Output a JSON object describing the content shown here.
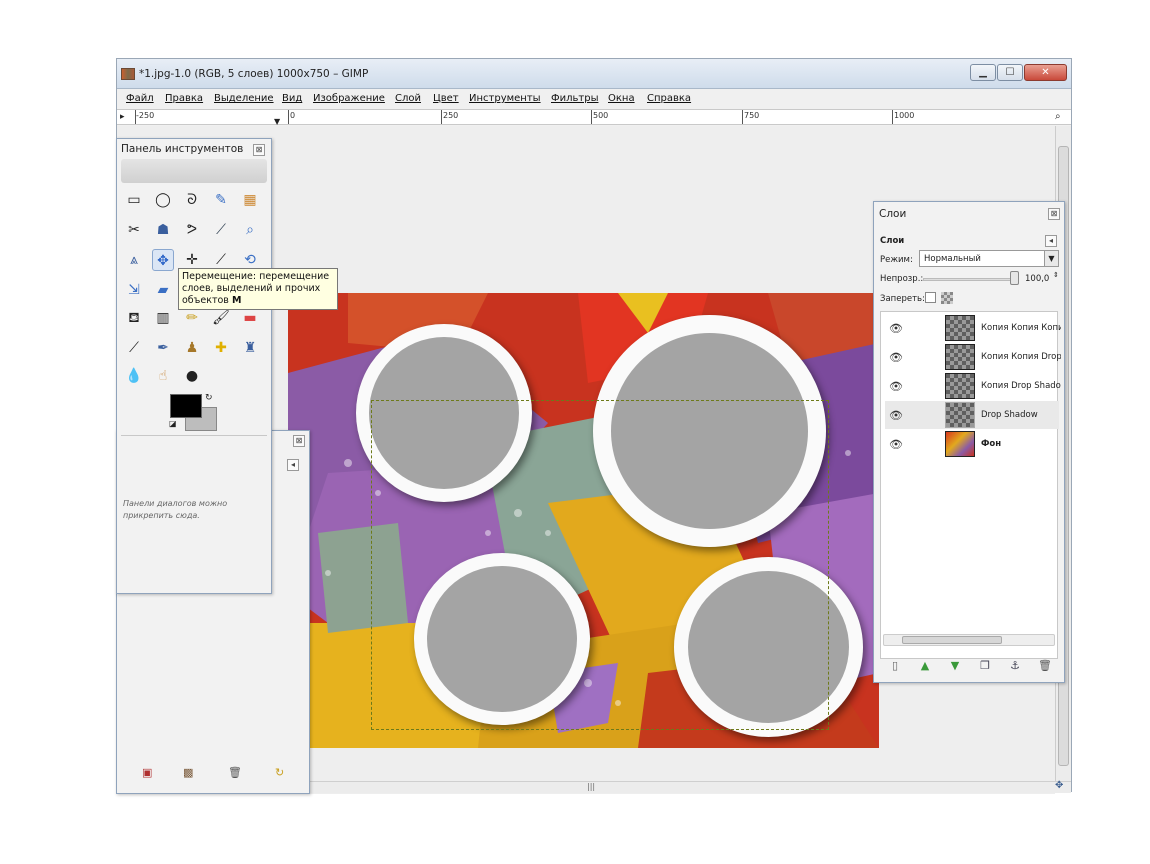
{
  "window": {
    "title": "*1.jpg-1.0 (RGB, 5 слоев) 1000x750 – GIMP",
    "app_icon": "gimp-icon",
    "controls": [
      "minimize-icon",
      "maximize-icon",
      "close-icon"
    ]
  },
  "menubar": [
    "Файл",
    "Правка",
    "Выделение",
    "Вид",
    "Изображение",
    "Слой",
    "Цвет",
    "Инструменты",
    "Фильтры",
    "Окна",
    "Справка"
  ],
  "ruler": [
    "-250",
    "0",
    "250",
    "500",
    "750",
    "1000"
  ],
  "toolbox": {
    "title": "Панель инструментов",
    "dock_hint": "Панели диалогов можно прикрепить сюда.",
    "fg_color": "#000000",
    "bg_color": "#bdbdbd",
    "tools": [
      "rect-select-icon",
      "ellipse-select-icon",
      "lasso-icon",
      "fuzzy-select-icon",
      "color-select-icon",
      "scissors-icon",
      "foreground-select-icon",
      "paths-icon",
      "color-picker-icon",
      "zoom-icon",
      "measure-icon",
      "move-icon",
      "align-icon",
      "crop-icon",
      "rotate-icon",
      "scale-icon",
      "shear-icon",
      "perspective-icon",
      "flip-icon",
      "text-icon",
      "bucket-fill-icon",
      "blend-icon",
      "pencil-icon",
      "paintbrush-icon",
      "eraser-icon",
      "airbrush-icon",
      "ink-icon",
      "clone-icon",
      "heal-icon",
      "perspective-clone-icon",
      "blur-icon",
      "smudge-icon",
      "dodge-burn-icon"
    ]
  },
  "tooltip": {
    "text": "Перемещение: перемещение слоев, выделений и прочих объектов",
    "shortcut": "M"
  },
  "layers": {
    "title": "Слои",
    "subtitle": "Слои",
    "mode_label": "Режим:",
    "mode_value": "Нормальный",
    "opacity_label": "Непрозр.:",
    "opacity_value": "100,0",
    "lock_label": "Запереть:",
    "items": [
      {
        "name": "Копия Копия Копия",
        "bold": false
      },
      {
        "name": "Копия Копия Drop",
        "bold": false
      },
      {
        "name": "Копия Drop Shadow",
        "bold": false
      },
      {
        "name": "Drop Shadow",
        "bold": false
      },
      {
        "name": "Фон",
        "bold": true
      }
    ],
    "buttons": [
      "new-layer-icon",
      "raise-layer-icon",
      "lower-layer-icon",
      "duplicate-layer-icon",
      "anchor-icon",
      "delete-layer-icon"
    ]
  },
  "dock2": {
    "buttons": [
      "save-icon",
      "image-icon",
      "trash-icon",
      "refresh-icon"
    ]
  }
}
